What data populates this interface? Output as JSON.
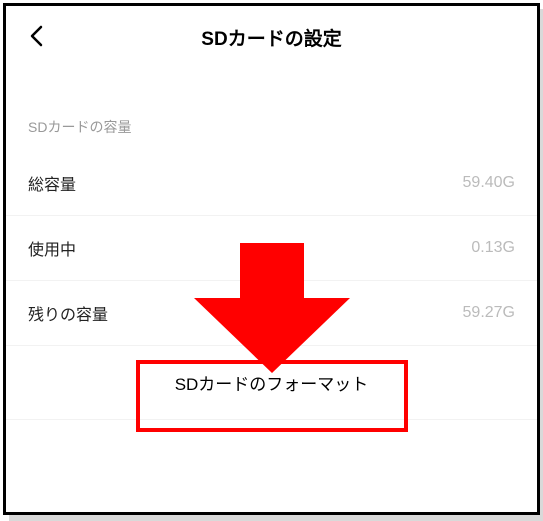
{
  "header": {
    "title": "SDカードの設定"
  },
  "section": {
    "capacity_header": "SDカードの容量"
  },
  "rows": {
    "total": {
      "label": "総容量",
      "value": "59.40G"
    },
    "used": {
      "label": "使用中",
      "value": "0.13G"
    },
    "remaining": {
      "label": "残りの容量",
      "value": "59.27G"
    }
  },
  "format": {
    "label": "SDカードのフォーマット"
  },
  "annotation": {
    "arrow_color": "#ff0000",
    "highlight_color": "#ff0000"
  }
}
